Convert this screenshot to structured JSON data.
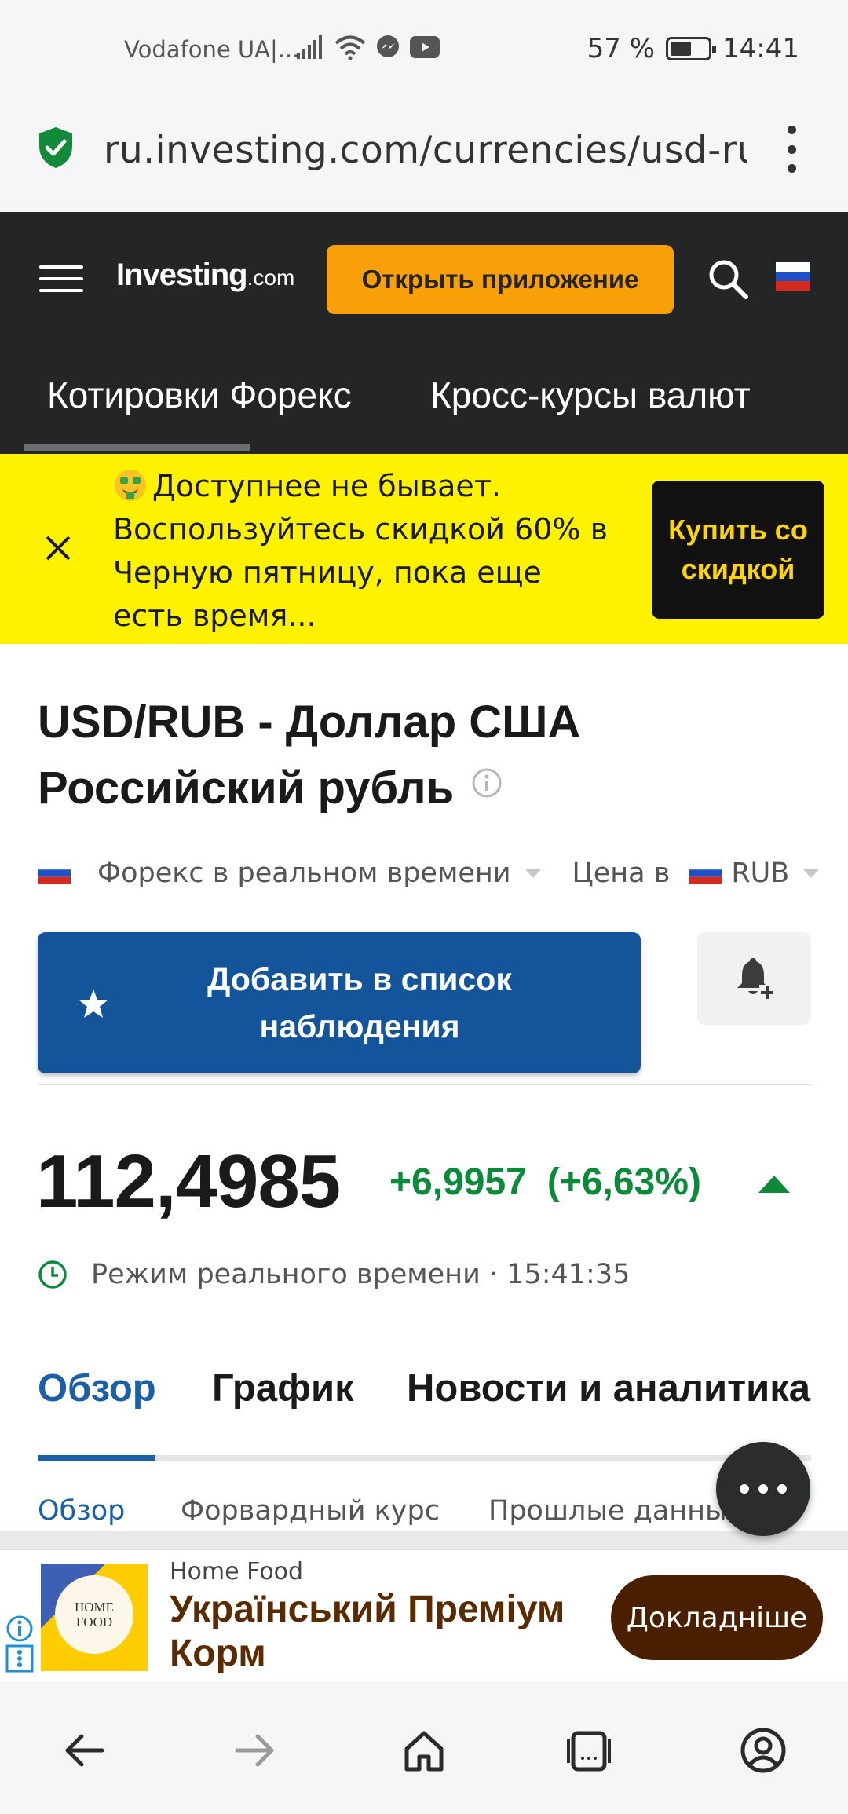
{
  "status_bar": {
    "carrier": "Vodafone UA|...",
    "battery": "57 %",
    "time": "14:41",
    "icons": [
      "signal-icon",
      "wifi-icon",
      "messenger-icon",
      "youtube-icon",
      "battery-icon"
    ]
  },
  "browser": {
    "url": "ru.investing.com/currencies/usd-rub",
    "icons": [
      "security-shield-icon",
      "overflow-menu-icon"
    ]
  },
  "header": {
    "logo": "Investing",
    "logo_suffix": ".com",
    "open_app_label": "Открыть приложение",
    "nav": [
      "Котировки Форекс",
      "Кросс-курсы валют"
    ]
  },
  "promo": {
    "text": "Доступнее не бывает. Воспользуйтесь скидкой 60% в Черную пятницу, пока еще есть время...",
    "button": "Купить со скидкой",
    "colors": {
      "background": "#fff200",
      "button_text": "#ffd400"
    }
  },
  "instrument": {
    "title": "USD/RUB - Доллар США Российский рубль",
    "market": "Форекс в реальном времени",
    "price_in_label": "Цена в",
    "currency": "RUB",
    "watchlist_button": "Добавить в список наблюдения",
    "price": "112,4985",
    "change": "+6,9957",
    "change_pct": "(+6,63%)",
    "realtime_label": "Режим реального времени · 15:41:35",
    "colors": {
      "positive": "#0b8a3a",
      "accent": "#13549b"
    }
  },
  "tabs": {
    "items": [
      "Обзор",
      "График",
      "Новости и аналитика"
    ],
    "active": "Обзор"
  },
  "subtabs": {
    "items": [
      "Обзор",
      "Форвардный курс",
      "Прошлые данные"
    ],
    "active": "Обзор"
  },
  "ad": {
    "brand": "Home Food",
    "logo_line1": "HOME",
    "logo_line2": "FOOD",
    "headline": "Український Преміум Корм",
    "cta": "Докладніше"
  },
  "bottom_nav": [
    "back-icon",
    "forward-icon",
    "home-icon",
    "tabs-icon",
    "account-icon"
  ]
}
